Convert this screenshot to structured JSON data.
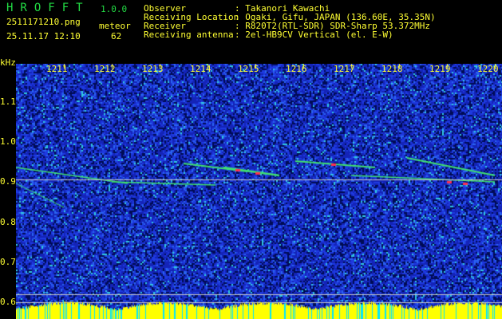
{
  "app": {
    "name": "HROFFT",
    "version": "1.0.0"
  },
  "file": {
    "name": "2511171210.png",
    "datetime": "25.11.17 12:10"
  },
  "meteor": {
    "label": "meteor",
    "count": "62"
  },
  "info": [
    {
      "label": "Observer",
      "value": ": Takanori Kawachi"
    },
    {
      "label": "Receiving Location",
      "value": ": Ogaki, Gifu, JAPAN (136.60E, 35.35N)"
    },
    {
      "label": "Receiver",
      "value": ": R820T2(RTL-SDR) SDR-Sharp 53.372MHz"
    },
    {
      "label": "Receiving antenna",
      "value": ": 2el-HB9CV Vertical (el. E-W)"
    }
  ],
  "chart_data": {
    "type": "heatmap",
    "ylabel": "kHz",
    "y_ticks": [
      "1.1",
      "1.0",
      "0.9",
      "0.8",
      "0.7",
      "0.6"
    ],
    "x_ticks": [
      "1211",
      "1212",
      "1213",
      "1214",
      "1215",
      "1216",
      "1217",
      "1218",
      "1219",
      "1220"
    ],
    "colors": {
      "background": "#000000",
      "noise": "#1a2acc",
      "text": "#ffff33",
      "logo": "#22dd44",
      "level": "#ffff00",
      "level_low": "#00e5ff"
    }
  }
}
